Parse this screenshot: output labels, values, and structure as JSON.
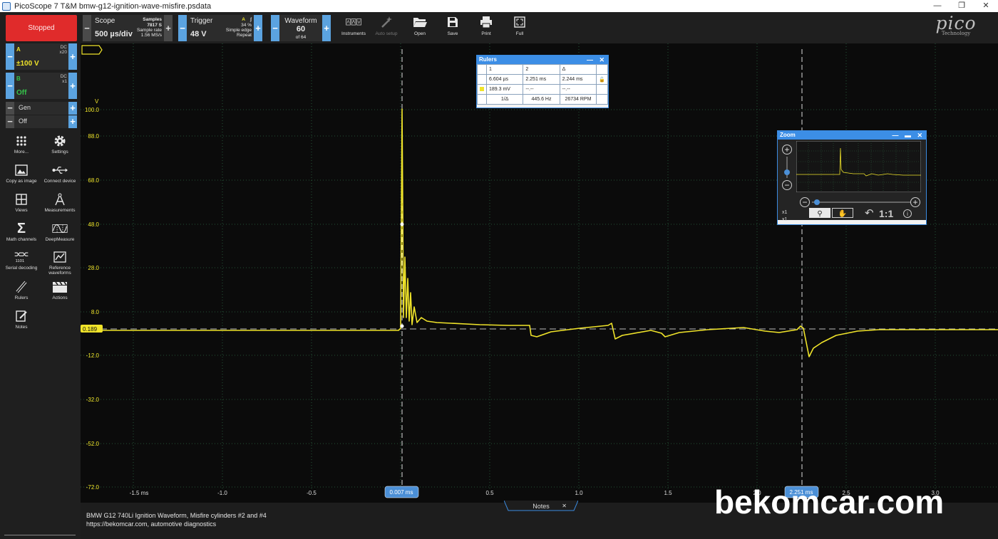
{
  "window": {
    "title": "PicoScope 7 T&M bmw-g12-ignition-wave-misfire.psdata",
    "minimize": "—",
    "restore": "❐",
    "close": "✕"
  },
  "toolbar": {
    "stopped_label": "Stopped",
    "scope": {
      "title": "Scope",
      "value": "500 µs/div",
      "samples_label": "Samples",
      "samples_value": "7817 S",
      "rate_label": "Sample rate",
      "rate_value": "1.56 MS/s"
    },
    "trigger": {
      "title": "Trigger",
      "value": "48 V",
      "channel": "A",
      "percent": "34 %",
      "type": "Simple edge",
      "mode": "Repeat"
    },
    "waveform": {
      "title": "Waveform",
      "value": "60",
      "of": "of 64"
    },
    "tools": [
      "Instruments",
      "Auto setup",
      "Open",
      "Save",
      "Print",
      "Full"
    ],
    "logo": "pico",
    "logo_sub": "Technology"
  },
  "channels": {
    "a": {
      "name": "A",
      "coupling": "DC",
      "probe": "x20",
      "range": "±100 V",
      "color": "#f0e42a"
    },
    "b": {
      "name": "B",
      "coupling": "DC",
      "probe": "x1",
      "range": "Off",
      "color": "#35c24a"
    },
    "gen": {
      "label": "Gen",
      "state": "Off"
    }
  },
  "sidebar": [
    {
      "label": "More...",
      "icon": "dots-grid-icon"
    },
    {
      "label": "Settings",
      "icon": "gear-icon"
    },
    {
      "label": "Copy as image",
      "icon": "image-icon"
    },
    {
      "label": "Connect device",
      "icon": "usb-icon"
    },
    {
      "label": "Views",
      "icon": "views-grid-icon"
    },
    {
      "label": "Measurements",
      "icon": "compass-icon"
    },
    {
      "label": "Math channels",
      "icon": "sigma-icon"
    },
    {
      "label": "DeepMeasure",
      "icon": "deepmeasure-icon"
    },
    {
      "label": "Serial decoding",
      "icon": "serial-icon"
    },
    {
      "label": "Reference waveforms",
      "icon": "reference-icon"
    },
    {
      "label": "Rulers",
      "icon": "ruler-icon"
    },
    {
      "label": "Actions",
      "icon": "clapper-icon"
    },
    {
      "label": "Notes",
      "icon": "notes-icon"
    }
  ],
  "plot": {
    "unit": "V",
    "y_ticks": [
      "100.0",
      "88.0",
      "68.0",
      "48.0",
      "28.0",
      "8.0",
      "-12.0",
      "-32.0",
      "-52.0",
      "-72.0"
    ],
    "x_ticks": [
      "-1.5 ms",
      "-1.0",
      "-0.5",
      "0.5",
      "1.0",
      "1.5",
      "2.0",
      "2.5",
      "3.0"
    ],
    "offset_label": "0.189",
    "ruler1_label": "0.007 ms",
    "ruler2_label": "2.251 ms",
    "trace_color": "#f0e42a"
  },
  "rulers_panel": {
    "title": "Rulers",
    "h1": "1",
    "h2": "2",
    "h3": "Δ",
    "t1": "6.604 µs",
    "t2": "2.251 ms",
    "td": "2.244 ms",
    "v1": "189.3 mV",
    "v2": "--.--",
    "vd": "--.--",
    "inv": "1/Δ",
    "freq": "445.6 Hz",
    "rpm": "26734 RPM"
  },
  "zoom_panel": {
    "title": "Zoom",
    "x1a": "x1",
    "x1b": "x1",
    "ratio": "1:1"
  },
  "footer": {
    "notes_tab": "Notes",
    "line1": "BMW G12 740Li Ignition Waveform, Misfire cylinders #2 and #4",
    "line2": "https://bekomcar.com, automotive diagnostics"
  },
  "watermark": "bekomcar.com"
}
